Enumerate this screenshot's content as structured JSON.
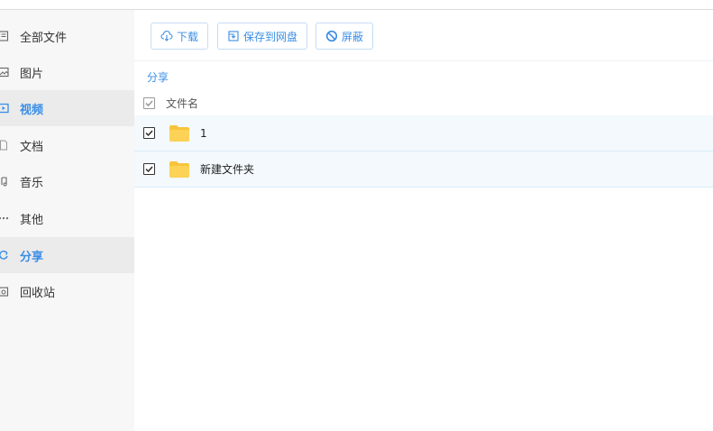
{
  "sidebar": {
    "items": [
      {
        "label": "全部文件",
        "icon": "file-list-icon",
        "active": false
      },
      {
        "label": "图片",
        "icon": "image-icon",
        "active": false
      },
      {
        "label": "视频",
        "icon": "video-icon",
        "active": true
      },
      {
        "label": "文档",
        "icon": "document-icon",
        "active": false
      },
      {
        "label": "音乐",
        "icon": "music-icon",
        "active": false
      },
      {
        "label": "其他",
        "icon": "more-icon",
        "active": false
      },
      {
        "label": "分享",
        "icon": "share-icon",
        "active": true
      },
      {
        "label": "回收站",
        "icon": "recycle-bin-icon",
        "active": false
      }
    ]
  },
  "toolbar": {
    "download_label": "下载",
    "save_label": "保存到网盘",
    "block_label": "屏蔽"
  },
  "breadcrumb": {
    "current": "分享"
  },
  "list": {
    "header_label": "文件名",
    "rows": [
      {
        "name": "1",
        "checked": true
      },
      {
        "name": "新建文件夹",
        "checked": true
      }
    ]
  },
  "colors": {
    "accent": "#3a8ee6",
    "folder": "#f8c43a",
    "row_selected": "#f3f9fd"
  }
}
